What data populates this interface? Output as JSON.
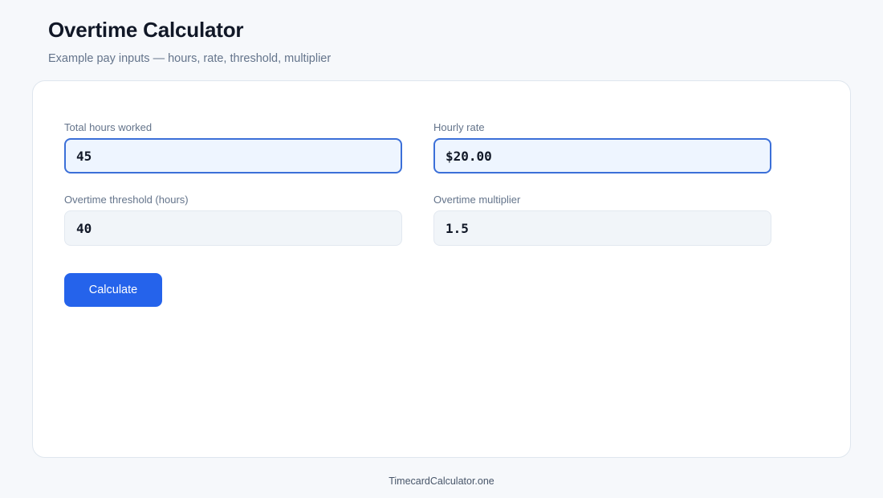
{
  "header": {
    "title": "Overtime Calculator",
    "subtitle": "Example pay inputs — hours, rate, threshold, multiplier"
  },
  "form": {
    "hours": {
      "label": "Total hours worked",
      "value": "45"
    },
    "rate": {
      "label": "Hourly rate",
      "value": "$20.00"
    },
    "threshold": {
      "label": "Overtime threshold (hours)",
      "value": "40"
    },
    "multiplier": {
      "label": "Overtime multiplier",
      "value": "1.5"
    },
    "submit_label": "Calculate"
  },
  "footer": {
    "brand": "TimecardCalculator.one"
  },
  "colors": {
    "accent": "#2563eb",
    "active_field_border": "#3b6fd8",
    "active_field_bg": "#eef5ff",
    "idle_field_bg": "#f1f5f9",
    "page_bg": "#f6f8fb"
  }
}
